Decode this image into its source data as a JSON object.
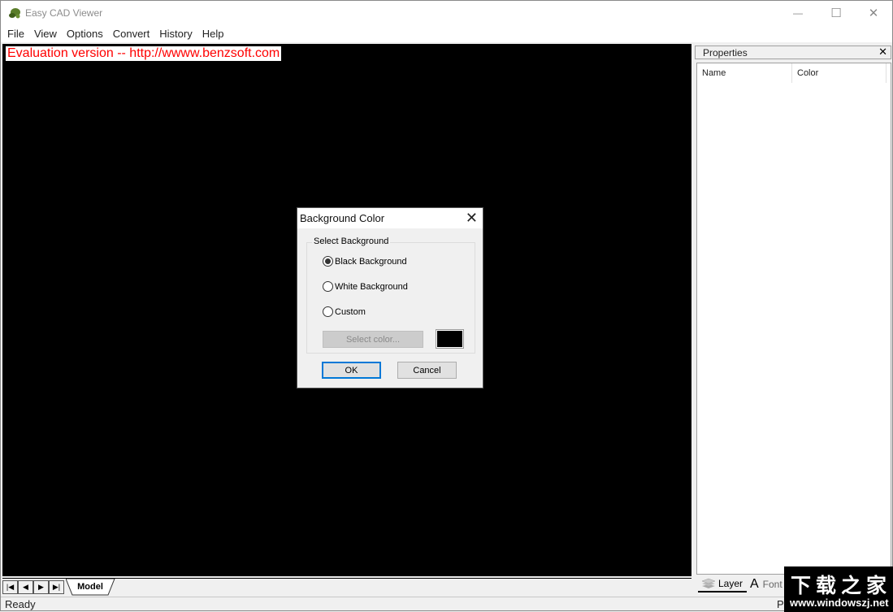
{
  "window": {
    "title": "Easy CAD Viewer",
    "controls": {
      "minimize": "—",
      "maximize": "☐",
      "close": "✕"
    }
  },
  "menu": [
    "File",
    "View",
    "Options",
    "Convert",
    "History",
    "Help"
  ],
  "canvas": {
    "background_color": "#000000",
    "eval_banner": "Evaluation version -- http://wwww.benzsoft.com",
    "eval_banner_color": "#ff0000"
  },
  "bottom_tabs": {
    "nav": {
      "first": "⏮",
      "prev": "◀",
      "next": "▶",
      "last": "⏭"
    },
    "active_tab": "Model"
  },
  "status": {
    "left": "Ready",
    "right": "P"
  },
  "properties": {
    "title": "Properties",
    "close": "✕",
    "columns": [
      "Name",
      "Color"
    ],
    "tabs": [
      {
        "icon": "layers-icon",
        "label": "Layer"
      },
      {
        "icon": "font-icon",
        "label": "Font",
        "glyph": "A"
      }
    ]
  },
  "dialog": {
    "title": "Background Color",
    "close": "✕",
    "group_label": "Select Background",
    "options": [
      {
        "label": "Black Background",
        "checked": true
      },
      {
        "label": "White Background",
        "checked": false
      },
      {
        "label": "Custom",
        "checked": false
      }
    ],
    "select_color_label": "Select color...",
    "swatch_color": "#000000",
    "ok_label": "OK",
    "cancel_label": "Cancel"
  },
  "watermark": {
    "cn": "下载之家",
    "url": "www.windowszj.net"
  }
}
